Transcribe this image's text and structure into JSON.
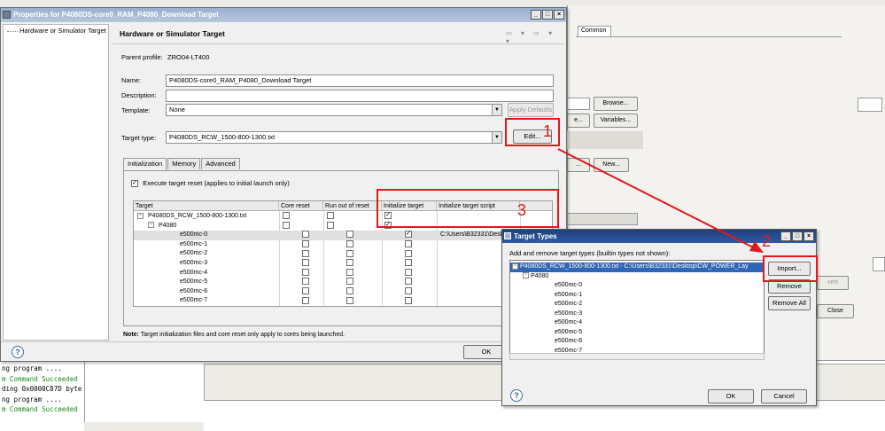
{
  "properties_dialog": {
    "title": "Properties for P4080DS-core0_RAM_P4080_Download Target",
    "nav_item": "Hardware or Simulator Target",
    "page_title": "Hardware or Simulator Target",
    "page_nav_arrows": "⇦ ▾ ⇨ ▾ ▾",
    "parent_profile_label": "Parent profile:",
    "parent_profile_value": "ZRO04-LT400",
    "name_label": "Name:",
    "name_value": "P4080DS-core0_RAM_P4080_Download Target",
    "description_label": "Description:",
    "description_value": "",
    "template_label": "Template:",
    "template_value": "None",
    "apply_defaults_label": "Apply Defaults",
    "target_type_label": "Target type:",
    "target_type_value": "P4080DS_RCW_1500-800-1300.txt",
    "edit_label": "Edit...",
    "tabs": [
      "Initialization",
      "Memory",
      "Advanced"
    ],
    "execute_reset_label": "Execute target reset (applies to initial launch only)",
    "columns": [
      "Target",
      "Core reset",
      "Run out of reset",
      "Initialize target",
      "Initialize target script"
    ],
    "rows": [
      {
        "name": "P4080DS_RCW_1500-800-1300.txt",
        "level": 0,
        "expand": "−",
        "core_reset": "",
        "run_out": "",
        "init": "✓",
        "script": ""
      },
      {
        "name": "P4080",
        "level": 1,
        "expand": "−",
        "core_reset": "",
        "run_out": "",
        "init": "✓",
        "script": ""
      },
      {
        "name": "e500mc-0",
        "level": 2,
        "expand": "",
        "core_reset": "",
        "run_out": "",
        "init": "✓",
        "script": "C:\\Users\\B32331\\Deskto..."
      },
      {
        "name": "e500mc-1",
        "level": 2,
        "expand": "",
        "core_reset": "",
        "run_out": "",
        "init": "",
        "script": ""
      },
      {
        "name": "e500mc-2",
        "level": 2,
        "expand": "",
        "core_reset": "",
        "run_out": "",
        "init": "",
        "script": ""
      },
      {
        "name": "e500mc-3",
        "level": 2,
        "expand": "",
        "core_reset": "",
        "run_out": "",
        "init": "",
        "script": ""
      },
      {
        "name": "e500mc-4",
        "level": 2,
        "expand": "",
        "core_reset": "",
        "run_out": "",
        "init": "",
        "script": ""
      },
      {
        "name": "e500mc-5",
        "level": 2,
        "expand": "",
        "core_reset": "",
        "run_out": "",
        "init": "",
        "script": ""
      },
      {
        "name": "e500mc-6",
        "level": 2,
        "expand": "",
        "core_reset": "",
        "run_out": "",
        "init": "",
        "script": ""
      },
      {
        "name": "e500mc-7",
        "level": 2,
        "expand": "",
        "core_reset": "",
        "run_out": "",
        "init": "",
        "script": ""
      }
    ],
    "note_bold": "Note:",
    "note_text": " Target initialization files and core reset only apply to cores being launched.",
    "ok_label": "OK",
    "help_icon": "?"
  },
  "target_types_dialog": {
    "title": "Target Types",
    "instructions": "Add and remove target types (builtin types not shown):",
    "items": [
      {
        "text": "P4080DS_RCW_1500-800-1300.txt - C:\\Users\\B32331\\Desktop\\CW_POWER_Lay",
        "level": 0,
        "expand": "−",
        "selected": true
      },
      {
        "text": "P4080",
        "level": 1,
        "expand": "−",
        "selected": false
      },
      {
        "text": "e500mc-0",
        "level": 2,
        "expand": "",
        "selected": false
      },
      {
        "text": "e500mc-1",
        "level": 2,
        "expand": "",
        "selected": false
      },
      {
        "text": "e500mc-2",
        "level": 2,
        "expand": "",
        "selected": false
      },
      {
        "text": "e500mc-3",
        "level": 2,
        "expand": "",
        "selected": false
      },
      {
        "text": "e500mc-4",
        "level": 2,
        "expand": "",
        "selected": false
      },
      {
        "text": "e500mc-5",
        "level": 2,
        "expand": "",
        "selected": false
      },
      {
        "text": "e500mc-6",
        "level": 2,
        "expand": "",
        "selected": false
      },
      {
        "text": "e500mc-7",
        "level": 2,
        "expand": "",
        "selected": false
      }
    ],
    "import_label": "Import...",
    "remove_label": "Remove",
    "remove_all_label": "Remove All",
    "ok_label": "OK",
    "cancel_label": "Cancel",
    "help_icon": "?"
  },
  "background": {
    "common_tab": "Common",
    "browse_label": "Browse...",
    "variables_label": "Variables...",
    "partial_ne_label": "e...",
    "new_label": "New...",
    "partial_label": "...",
    "revert_label": "vert",
    "close_label": "Close",
    "console_lines": [
      {
        "text": "ng program ....",
        "green": false
      },
      {
        "text": "m Command Succeeded",
        "green": true
      },
      {
        "text": "ding 0x0000C87D byte",
        "green": false
      },
      {
        "text": "ng program ....",
        "green": false
      },
      {
        "text": "m Command Succeeded",
        "green": true
      }
    ]
  },
  "annotations": {
    "num1": "1",
    "num2": "2",
    "num3": "3",
    "color": "#e01a1a"
  },
  "window_buttons": {
    "minimize": "_",
    "maximize": "□",
    "close": "×"
  }
}
